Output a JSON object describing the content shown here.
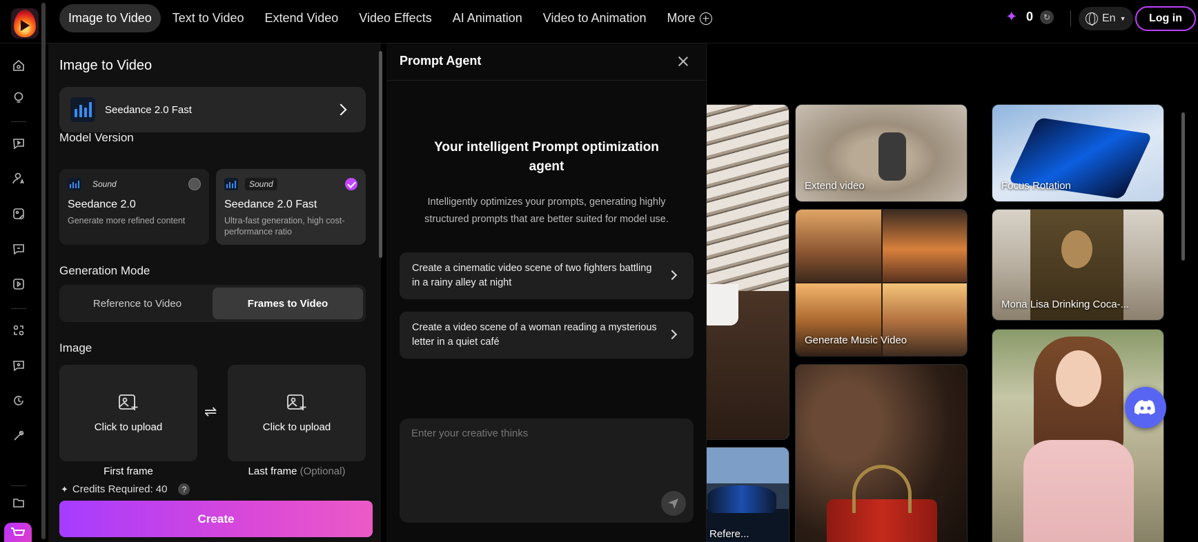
{
  "nav": {
    "items": [
      "Image to Video",
      "Text to Video",
      "Extend Video",
      "Video Effects",
      "AI Animation",
      "Video to Animation"
    ],
    "more_label": "More",
    "credits": "0",
    "language": "En",
    "login_label": "Log in"
  },
  "panel": {
    "title": "Image to Video",
    "selected_model": "Seedance 2.0 Fast",
    "model_version_label": "Model Version",
    "versions": [
      {
        "tag": "Sound",
        "name": "Seedance 2.0",
        "desc": "Generate more refined content",
        "selected": false
      },
      {
        "tag": "Sound",
        "name": "Seedance 2.0 Fast",
        "desc": "Ultra-fast generation, high cost-performance ratio",
        "selected": true
      }
    ],
    "generation_mode_label": "Generation Mode",
    "modes": [
      "Reference to Video",
      "Frames to Video"
    ],
    "active_mode": "Frames to Video",
    "image_label": "Image",
    "upload_label": "Click to upload",
    "first_frame_label": "First frame",
    "last_frame_label": "Last frame",
    "last_frame_optional": "(Optional)",
    "credits_required": "Credits Required: 40",
    "create_label": "Create"
  },
  "agent": {
    "title": "Prompt Agent",
    "heading": "Your intelligent Prompt optimization agent",
    "subtitle": "Intelligently optimizes your prompts, generating highly structured prompts that are better suited for model use.",
    "suggestions": [
      "Create a cinematic video scene of two fighters battling in a rainy alley at night",
      "Create a video scene of a woman reading a mysterious letter in a quiet café"
    ],
    "input_placeholder": "Enter your creative thinks"
  },
  "gallery": {
    "cards": [
      "Extend video",
      "Focus Rotation",
      "Generate Music Video",
      "Mona Lisa Drinking Coca-...",
      "Refere..."
    ]
  },
  "colors": {
    "accent": "#c046ff",
    "create_gradient_start": "#a63cff",
    "create_gradient_end": "#ec5ac7",
    "discord": "#5865f2"
  }
}
